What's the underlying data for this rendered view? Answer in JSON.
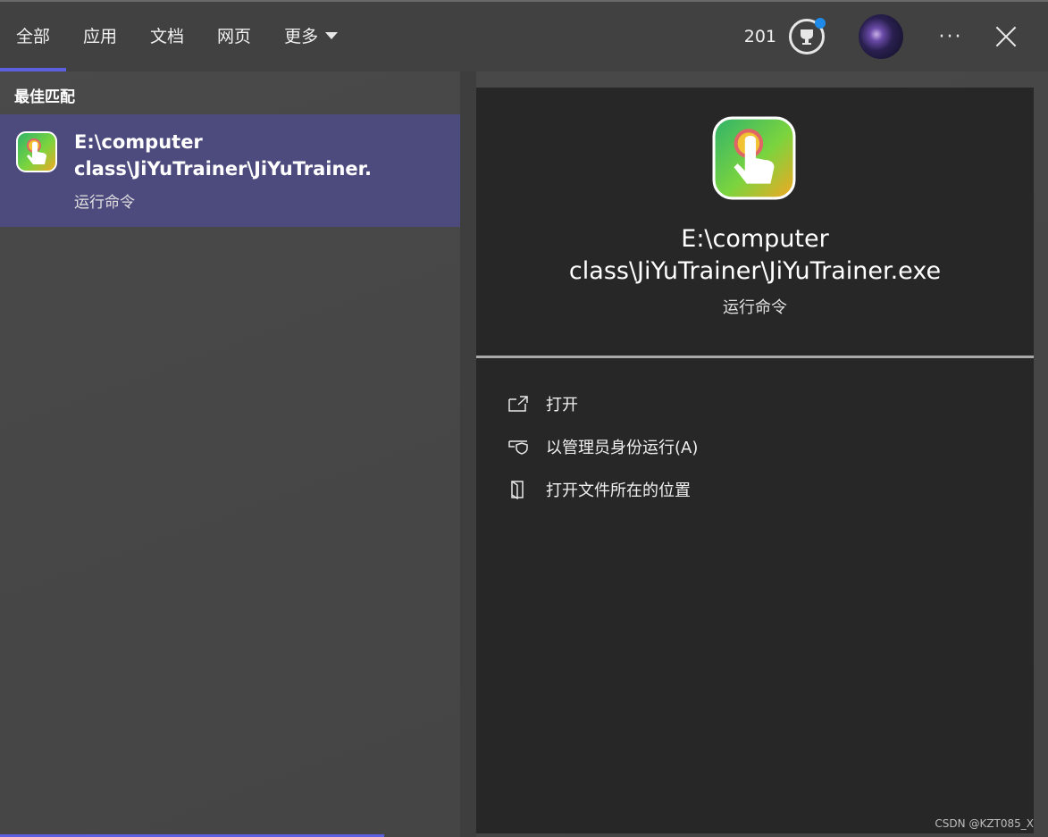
{
  "tabs": [
    {
      "label": "全部",
      "active": true
    },
    {
      "label": "应用",
      "active": false
    },
    {
      "label": "文档",
      "active": false
    },
    {
      "label": "网页",
      "active": false
    },
    {
      "label": "更多",
      "active": false
    }
  ],
  "header": {
    "points": "201",
    "trophy_icon": "trophy-icon",
    "notification_color": "#1e8be8",
    "more_label": "···"
  },
  "best_match": {
    "section_title": "最佳匹配",
    "item": {
      "title": "E:\\computer\nclass\\JiYuTrainer\\JiYuTrainer.",
      "subtitle": "运行命令",
      "highlight_color": "#4d4b7e"
    }
  },
  "detail": {
    "title": "E:\\computer\nclass\\JiYuTrainer\\JiYuTrainer.exe",
    "subtitle": "运行命令",
    "actions": [
      {
        "label": "打开",
        "icon": "open-icon"
      },
      {
        "label": "以管理员身份运行(A)",
        "icon": "shield-icon"
      },
      {
        "label": "打开文件所在的位置",
        "icon": "folder-icon"
      }
    ]
  },
  "watermark": "CSDN @KZT085_X",
  "accent_color": "#5b5fe0"
}
